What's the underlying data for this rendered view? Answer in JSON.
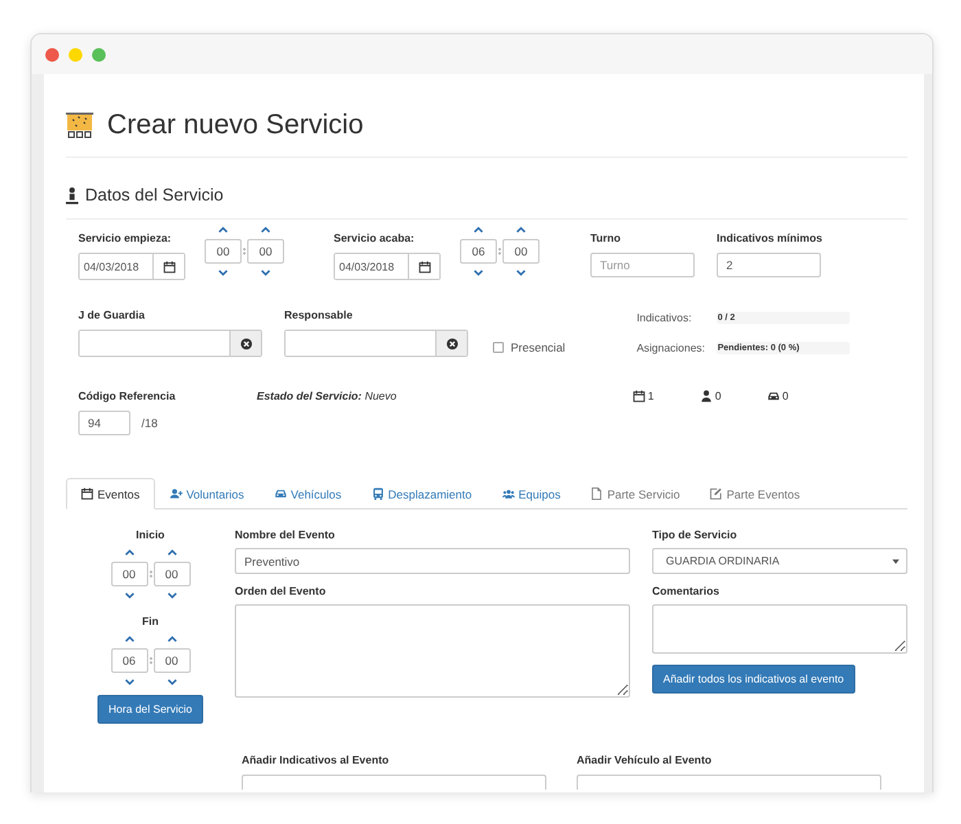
{
  "page": {
    "title": "Crear nuevo Servicio"
  },
  "section": {
    "title": "Datos del Servicio"
  },
  "start": {
    "label": "Servicio empieza:",
    "date": "04/03/2018",
    "hour": "00",
    "minute": "00"
  },
  "end": {
    "label": "Servicio acaba:",
    "date": "04/03/2018",
    "hour": "06",
    "minute": "00"
  },
  "turno": {
    "label": "Turno",
    "placeholder": "Turno"
  },
  "min_indicativos": {
    "label": "Indicativos mínimos",
    "value": "2"
  },
  "guard": {
    "label": "J de Guardia"
  },
  "responsible": {
    "label": "Responsable"
  },
  "presencial": {
    "label": "Presencial",
    "checked": false
  },
  "progress": [
    {
      "label": "Indicativos:",
      "text": "0 / 2",
      "level": 0
    },
    {
      "label": "Asignaciones:",
      "text": "Pendientes: 0 (0 %)",
      "level": 0
    }
  ],
  "reference": {
    "label": "Código Referencia",
    "value": "94",
    "suffix": "/18"
  },
  "status": {
    "label": "Estado del Servicio:",
    "value": "Nuevo"
  },
  "counts": [
    {
      "kind": "calendar",
      "value": "1"
    },
    {
      "kind": "person",
      "value": "0"
    },
    {
      "kind": "car",
      "value": "0"
    }
  ],
  "tabs": [
    {
      "label": "Eventos",
      "kind": "calendar",
      "selected": true,
      "disabled": false
    },
    {
      "label": "Voluntarios",
      "kind": "user-plus",
      "selected": false,
      "disabled": false
    },
    {
      "label": "Vehículos",
      "kind": "car",
      "selected": false,
      "disabled": false
    },
    {
      "label": "Desplazamiento",
      "kind": "bus",
      "selected": false,
      "disabled": false
    },
    {
      "label": "Equipos",
      "kind": "users",
      "selected": false,
      "disabled": false
    },
    {
      "label": "Parte Servicio",
      "kind": "file",
      "selected": false,
      "disabled": true
    },
    {
      "label": "Parte Eventos",
      "kind": "edit",
      "selected": false,
      "disabled": true
    }
  ],
  "event": {
    "times": [
      {
        "label": "Inicio",
        "hour": "00",
        "minute": "00"
      },
      {
        "label": "Fin",
        "hour": "06",
        "minute": "00"
      }
    ],
    "service_time_button": "Hora del Servicio",
    "name": {
      "label": "Nombre del Evento",
      "value": "Preventivo"
    },
    "order": {
      "label": "Orden del Evento"
    },
    "type": {
      "label": "Tipo de Servicio",
      "value": "GUARDIA ORDINARIA"
    },
    "comments": {
      "label": "Comentarios"
    },
    "add_all_button": "Añadir todos los indicativos al evento",
    "add_indicativos": {
      "label": "Añadir Indicativos al Evento"
    },
    "add_vehicle": {
      "label": "Añadir Vehículo al Evento"
    }
  }
}
